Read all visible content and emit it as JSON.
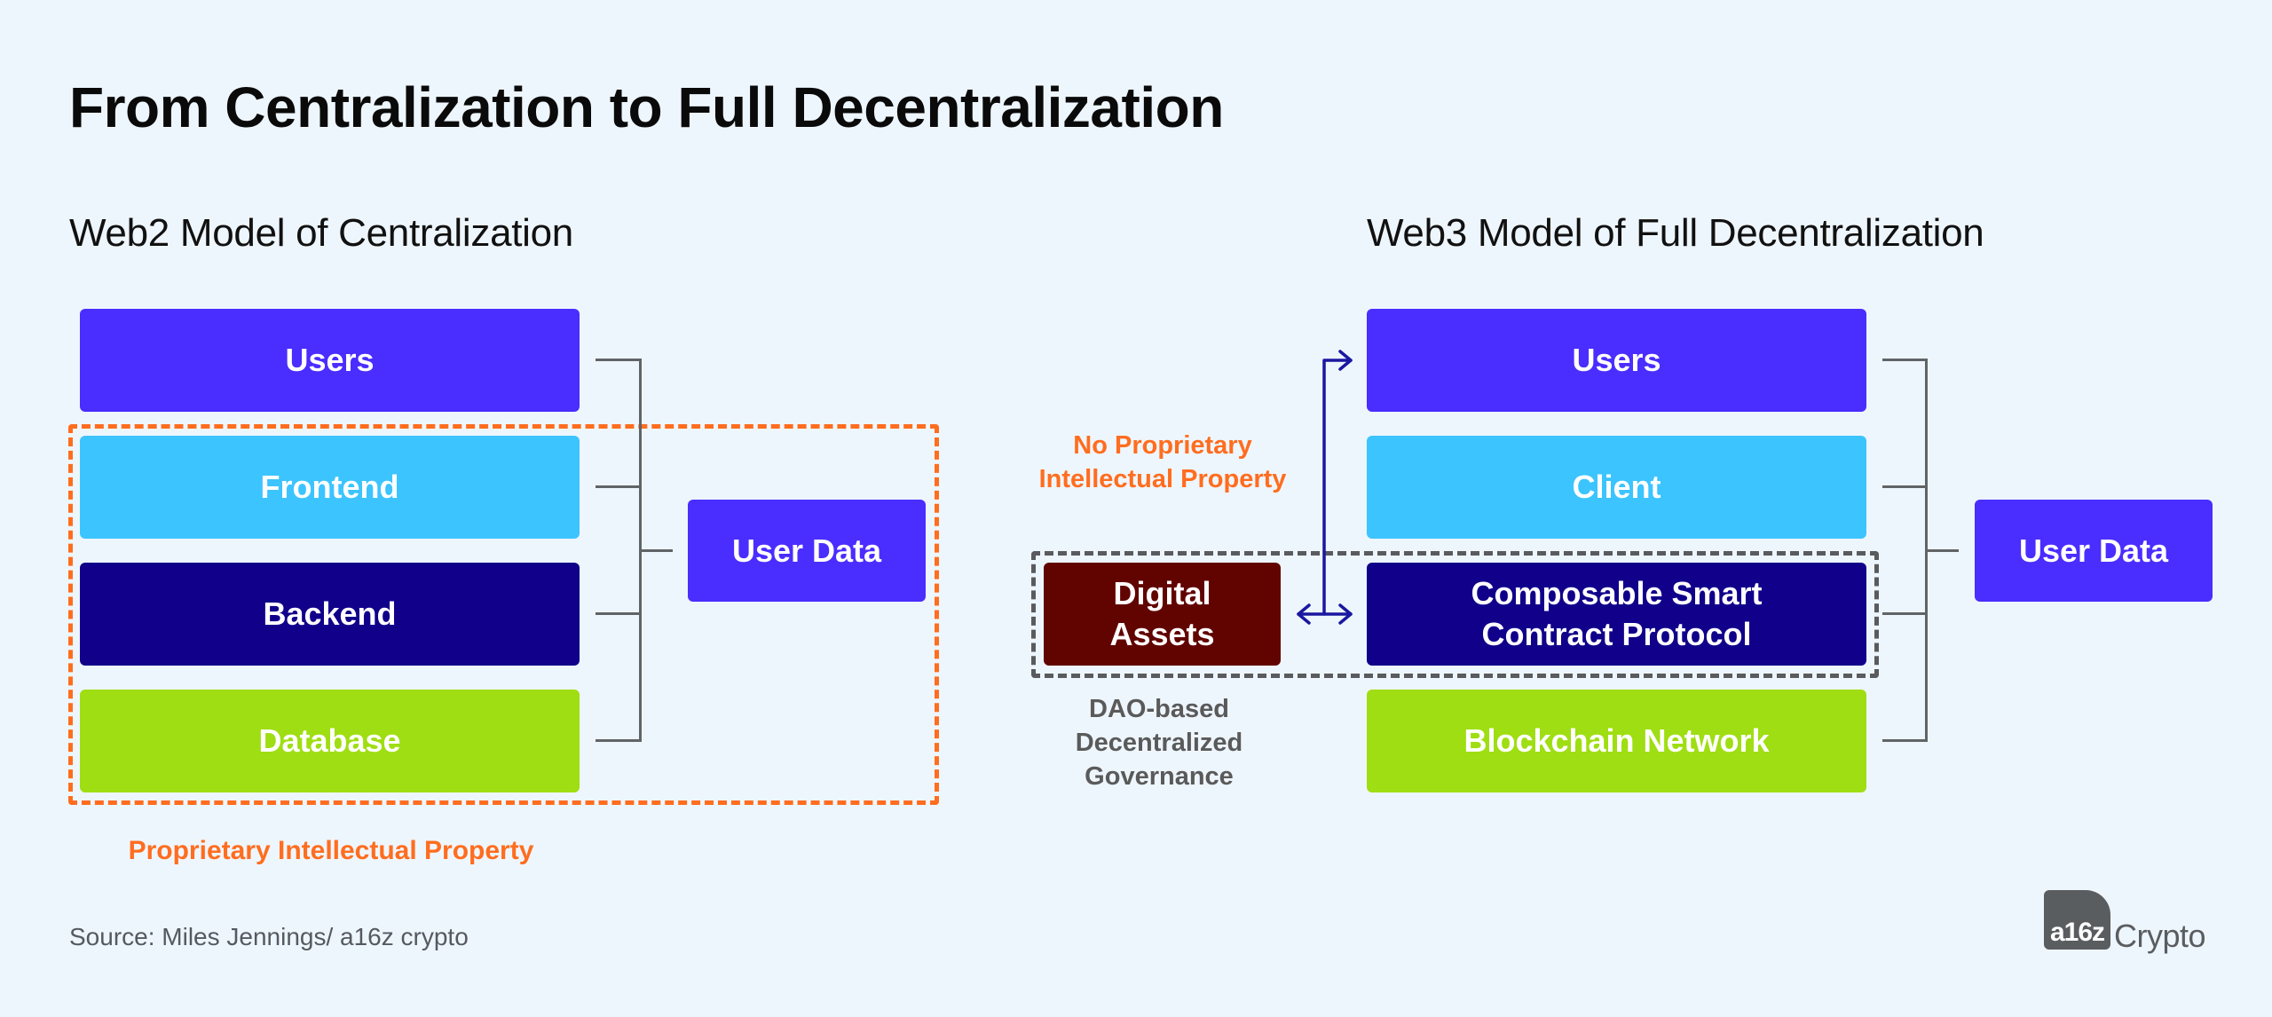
{
  "title": "From Centralization to Full Decentralization",
  "web2": {
    "heading": "Web2 Model of Centralization",
    "layers": [
      {
        "label": "Users",
        "color": "#4a2dff"
      },
      {
        "label": "Frontend",
        "color": "#3cc4ff"
      },
      {
        "label": "Backend",
        "color": "#10008a"
      },
      {
        "label": "Database",
        "color": "#9fde12"
      }
    ],
    "user_data": {
      "label": "User Data",
      "color": "#4a2dff"
    },
    "boundary_label": "Proprietary Intellectual Property",
    "boundary_color": "#ff6d1f"
  },
  "web3": {
    "heading": "Web3 Model of Full Decentralization",
    "layers": [
      {
        "label": "Users",
        "color": "#4a2dff"
      },
      {
        "label": "Client",
        "color": "#3cc4ff"
      },
      {
        "label": "Composable Smart Contract Protocol",
        "line1": "Composable Smart",
        "line2": "Contract Protocol",
        "color": "#10008a"
      },
      {
        "label": "Blockchain Network",
        "color": "#9fde12"
      }
    ],
    "user_data": {
      "label": "User Data",
      "color": "#4a2dff"
    },
    "digital_assets": {
      "label": "Digital Assets",
      "line1": "Digital",
      "line2": "Assets",
      "color": "#610400"
    },
    "no_ip_label": {
      "line1": "No Proprietary",
      "line2": "Intellectual Property",
      "color": "#ff6d1f"
    },
    "governance_label": {
      "line1": "DAO-based",
      "line2": "Decentralized",
      "line3": "Governance",
      "color": "#5a5a5a"
    },
    "arrow_color": "#1a17a0",
    "boundary_color": "#595b5e"
  },
  "footer": {
    "source": "Source:  Miles Jennings/ a16z crypto",
    "logo_mark": "a16z",
    "logo_word": "Crypto"
  }
}
